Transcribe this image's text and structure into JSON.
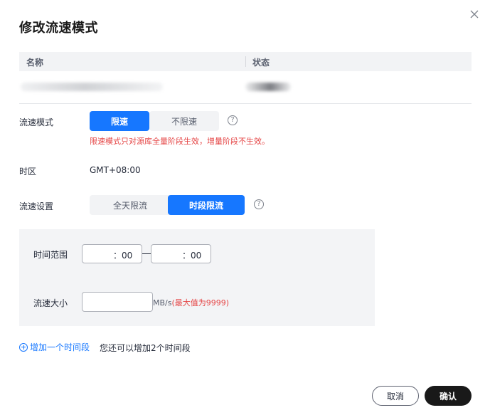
{
  "dialog": {
    "title": "修改流速模式",
    "close_icon": "close-icon"
  },
  "table": {
    "headers": [
      "名称",
      "状态"
    ]
  },
  "form": {
    "mode_label": "流速模式",
    "mode_options": [
      "限速",
      "不限速"
    ],
    "mode_selected": "限速",
    "mode_warning": "限速模式只对源库全量阶段生效，增量阶段不生效。",
    "tz_label": "时区",
    "tz_value": "GMT+08:00",
    "setting_label": "流速设置",
    "setting_options": [
      "全天限流",
      "时段限流"
    ],
    "setting_selected": "时段限流",
    "help_icon": "question-circle-icon",
    "help_glyph": "?"
  },
  "period": {
    "range_label": "时间范围",
    "start_time": "：00",
    "end_time": "：00",
    "size_label": "流速大小",
    "size_value": "",
    "unit": "MB/s",
    "max_hint": "(最大值为9999)"
  },
  "add": {
    "link": "增加一个时间段",
    "hint": "您还可以增加2个时间段"
  },
  "footer": {
    "cancel": "取消",
    "confirm": "确认"
  },
  "colors": {
    "primary": "#1677ff",
    "warning": "#e54545",
    "confirm_bg": "#191919"
  }
}
